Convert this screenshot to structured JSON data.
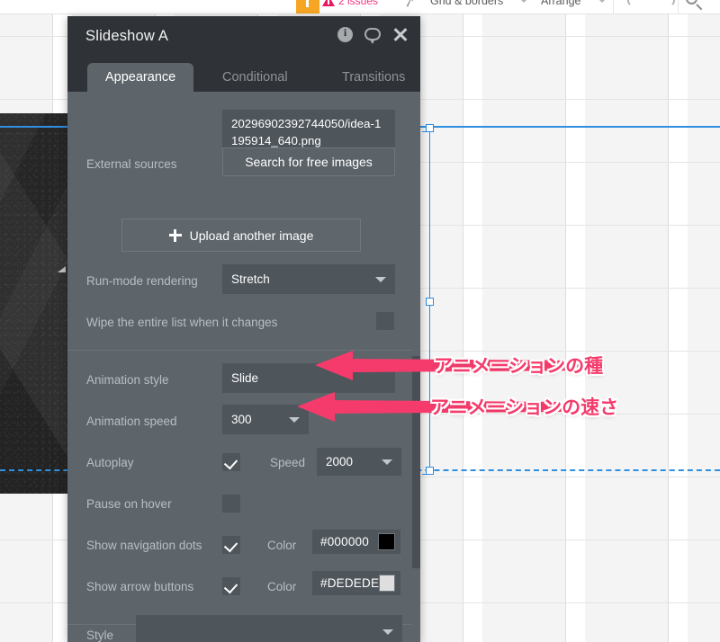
{
  "toolbar": {
    "issues_label": "2 issues",
    "items": [
      {
        "label": "Grid & borders",
        "has_caret": true
      },
      {
        "label": "Arrange",
        "has_caret": true
      }
    ],
    "icons": [
      "warning-triangle-icon",
      "cursor-arrow-icon",
      "undo-icon",
      "redo-icon",
      "search-icon"
    ]
  },
  "panel": {
    "title": "Slideshow A",
    "header_icons": [
      "info-icon",
      "comment-icon",
      "close-icon"
    ],
    "tabs": [
      {
        "label": "Appearance",
        "active": true
      },
      {
        "label": "Conditional",
        "active": false
      },
      {
        "label": "Transitions",
        "active": false
      }
    ],
    "fields": {
      "filename": "20296902392744050/idea-1195914_640.png",
      "external_sources_label": "External sources",
      "search_free_images_label": "Search for free images",
      "upload_label": "Upload another image",
      "run_mode_label": "Run-mode rendering",
      "run_mode_value": "Stretch",
      "wipe_label": "Wipe the entire list when it changes",
      "wipe_checked": false,
      "animation_style_label": "Animation style",
      "animation_style_value": "Slide",
      "animation_speed_label": "Animation speed",
      "animation_speed_value": "300",
      "autoplay_label": "Autoplay",
      "autoplay_checked": true,
      "speed_label": "Speed",
      "speed_value": "2000",
      "pause_on_hover_label": "Pause on hover",
      "pause_on_hover_checked": false,
      "nav_dots_label": "Show navigation dots",
      "nav_dots_checked": true,
      "nav_dots_color_label": "Color",
      "nav_dots_color_value": "#000000",
      "arrow_buttons_label": "Show arrow buttons",
      "arrow_buttons_checked": true,
      "arrow_buttons_color_label": "Color",
      "arrow_buttons_color_value": "#DEDEDE",
      "style_label": "Style",
      "style_value": ""
    }
  },
  "annotations": [
    {
      "text": "アニメーションの種",
      "target": "animation-style-field"
    },
    {
      "text": "アニメーションの速さ",
      "target": "animation-speed-field"
    }
  ],
  "colors": {
    "panel_bg": "#5d656b",
    "panel_header_bg": "#2f3337",
    "field_bg": "#4e555b",
    "accent_pink": "#f53b6b",
    "selection_blue": "#2d8ae5",
    "badge_orange": "#f7a623",
    "nav_dots_swatch": "#000000",
    "arrow_buttons_swatch": "#DEDEDE"
  }
}
